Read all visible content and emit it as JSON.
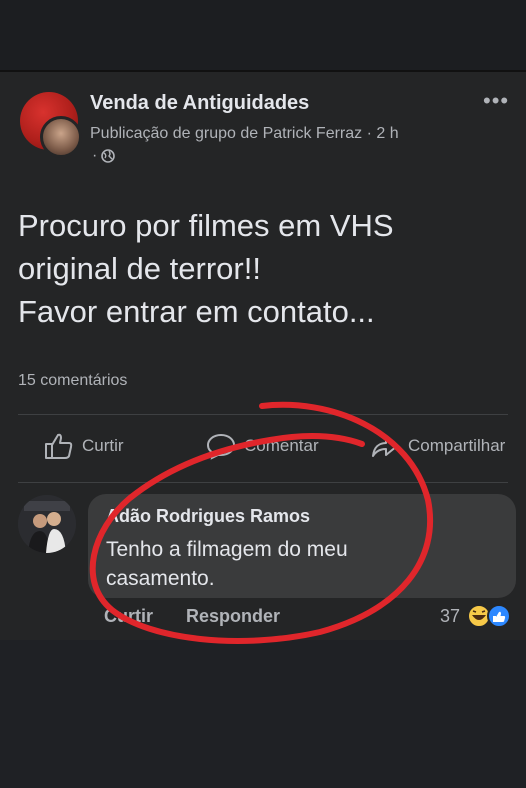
{
  "post": {
    "group_name": "Venda de Antiguidades",
    "meta": "Publicação de grupo de Patrick Ferraz · 2 h",
    "meta_suffix": "·",
    "more_label": "•••",
    "text_lines": [
      "Procuro por filmes em VHS",
      "original de terror!!",
      "Favor entrar em contato..."
    ],
    "comments_count": "15 comentários"
  },
  "actions": {
    "like": "Curtir",
    "comment": "Comentar",
    "share": "Compartilhar"
  },
  "comment": {
    "author": "Adão Rodrigues Ramos",
    "text_lines": [
      "Tenho a filmagem do meu",
      "casamento."
    ],
    "like": "Curtir",
    "reply": "Responder",
    "reactions_count": "37",
    "reaction_icons": [
      "laugh-reaction-icon",
      "like-reaction-icon"
    ]
  },
  "colors": {
    "background": "#242526",
    "text": "#e4e6eb",
    "secondary": "#b0b3b8",
    "annotation": "#e0262b"
  }
}
